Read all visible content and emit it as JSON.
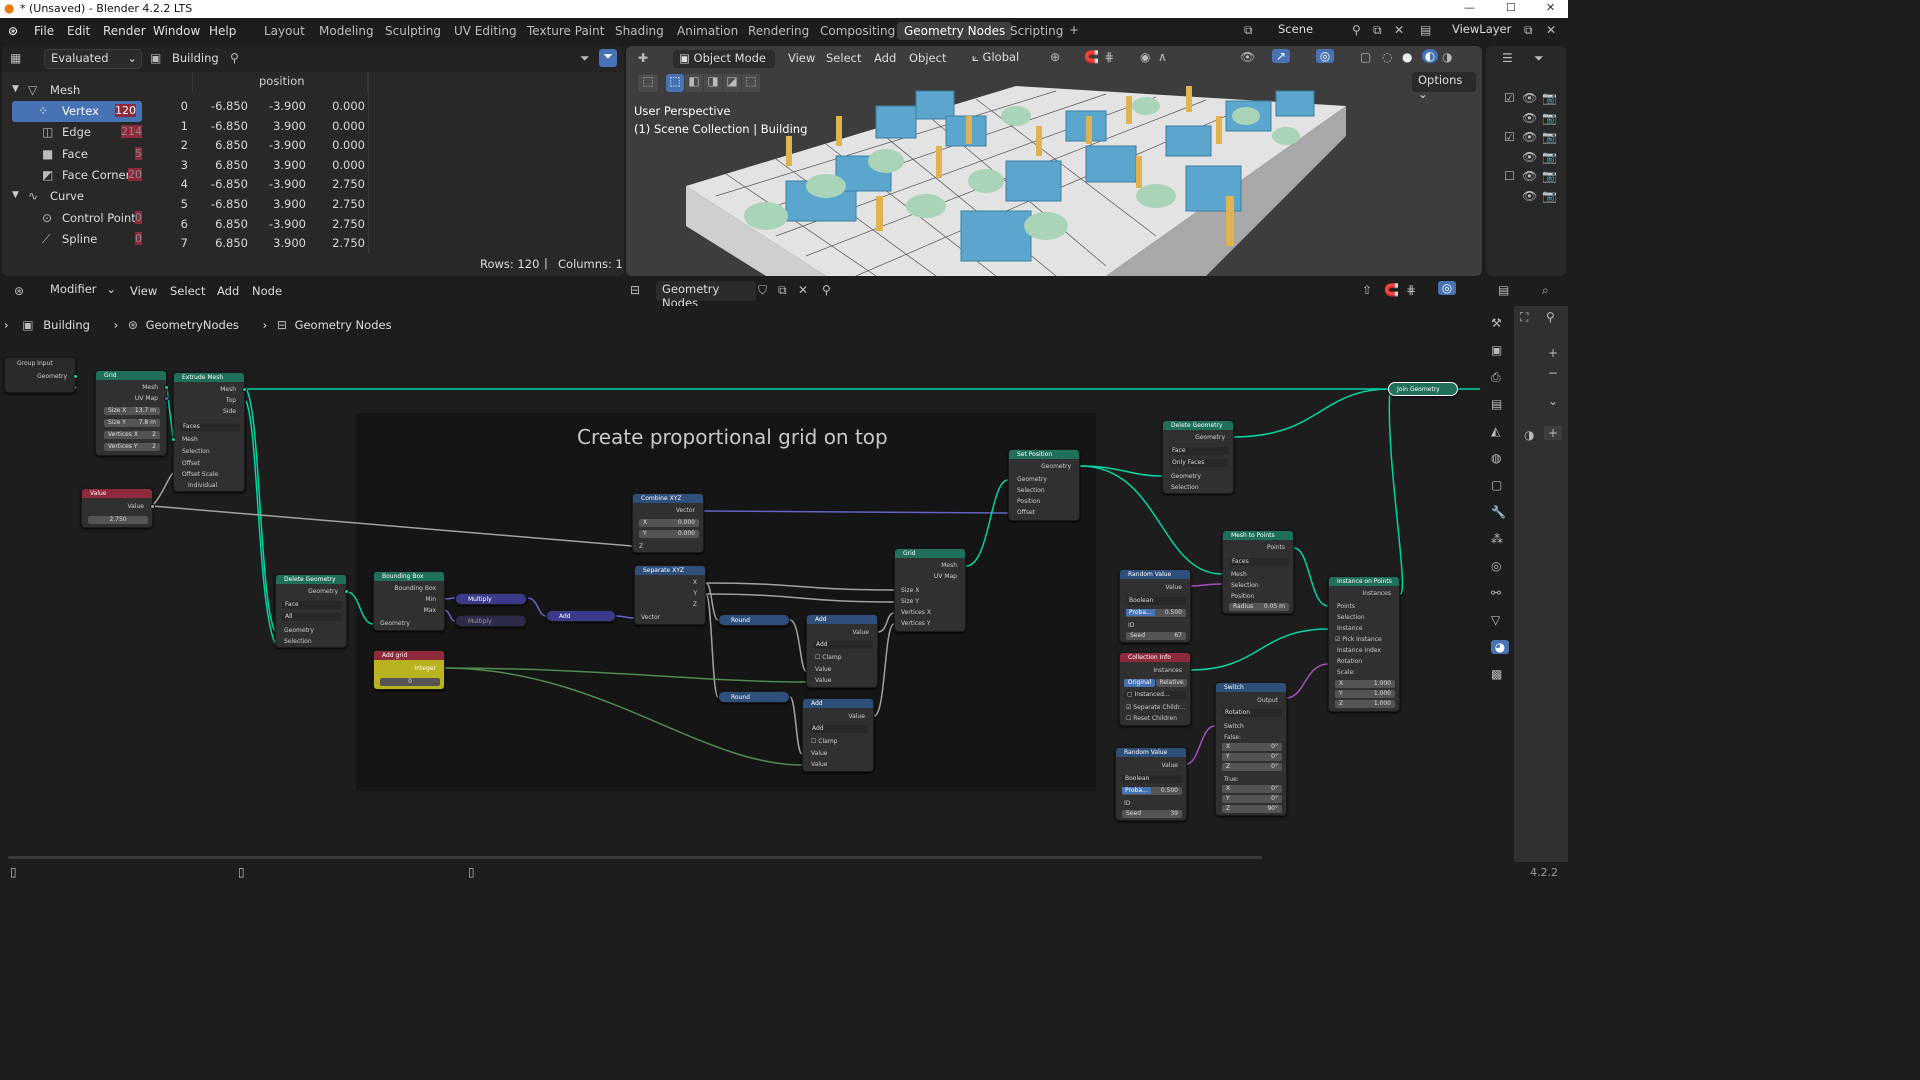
{
  "window": {
    "title": "* (Unsaved) - Blender 4.2.2 LTS"
  },
  "menu": [
    "File",
    "Edit",
    "Render",
    "Window",
    "Help"
  ],
  "workspaces": [
    "Layout",
    "Modeling",
    "Sculpting",
    "UV Editing",
    "Texture Paint",
    "Shading",
    "Animation",
    "Rendering",
    "Compositing",
    "Geometry Nodes",
    "Scripting"
  ],
  "active_workspace": "Geometry Nodes",
  "scene": {
    "scene_label": "Scene",
    "viewlayer_label": "ViewLayer"
  },
  "spreadsheet": {
    "evaluated": "Evaluated",
    "object": "Building",
    "column_header": "position",
    "domains": [
      {
        "group": "Mesh"
      },
      {
        "name": "Vertex",
        "count": "120"
      },
      {
        "name": "Edge",
        "count": "214"
      },
      {
        "name": "Face",
        "count": "5"
      },
      {
        "name": "Face Corner",
        "count": "20"
      },
      {
        "group": "Curve"
      },
      {
        "name": "Control Point",
        "count": "0"
      },
      {
        "name": "Spline",
        "count": "0"
      }
    ],
    "rows": [
      [
        "0",
        "-6.850",
        "-3.900",
        "0.000"
      ],
      [
        "1",
        "-6.850",
        "3.900",
        "0.000"
      ],
      [
        "2",
        "6.850",
        "-3.900",
        "0.000"
      ],
      [
        "3",
        "6.850",
        "3.900",
        "0.000"
      ],
      [
        "4",
        "-6.850",
        "-3.900",
        "2.750"
      ],
      [
        "5",
        "-6.850",
        "3.900",
        "2.750"
      ],
      [
        "6",
        "6.850",
        "-3.900",
        "2.750"
      ],
      [
        "7",
        "6.850",
        "3.900",
        "2.750"
      ]
    ],
    "footer_rows": "Rows: 120",
    "footer_cols": "Columns: 1"
  },
  "viewport": {
    "mode": "Object Mode",
    "menus": [
      "View",
      "Select",
      "Add",
      "Object"
    ],
    "orientation": "Global",
    "options": "Options",
    "perspective": "User Perspective",
    "collection": "(1) Scene Collection | Building"
  },
  "node_editor": {
    "editor_type": "Modifier",
    "menus": [
      "View",
      "Select",
      "Add",
      "Node"
    ],
    "tree_name": "Geometry Nodes",
    "breadcrumb": [
      "Building",
      "GeometryNodes",
      "Geometry Nodes"
    ],
    "frame_label": "Create proportional grid on top",
    "version": "4.2.2"
  },
  "nodes": {
    "group_input": {
      "title": "Group Input",
      "out": "Geometry"
    },
    "grid1": {
      "title": "Grid",
      "outs": [
        "Mesh",
        "UV Map"
      ],
      "size_x": "13.7 m",
      "size_y": "7.8 m",
      "verts_x": "2",
      "verts_y": "2"
    },
    "extrude": {
      "title": "Extrude Mesh",
      "outs": [
        "Mesh",
        "Top",
        "Side"
      ],
      "mode": "Faces",
      "ins": [
        "Mesh",
        "Selection",
        "Offset",
        "Offset Scale",
        "Individual"
      ]
    },
    "value": {
      "title": "Value",
      "label": "Value",
      "val": "2.750"
    },
    "delete1": {
      "title": "Delete Geometry",
      "out": "Geometry",
      "d1": "Face",
      "d2": "All",
      "ins": [
        "Geometry",
        "Selection"
      ]
    },
    "bbox": {
      "title": "Bounding Box",
      "outs": [
        "Bounding Box",
        "Min",
        "Max"
      ],
      "in": "Geometry"
    },
    "multiply1": "Multiply",
    "multiply2": "Multiply",
    "add_vec": "Add",
    "add_grid": {
      "title": "Add grid",
      "label": "Integer",
      "val": "0"
    },
    "combine": {
      "title": "Combine XYZ",
      "out": "Vector",
      "x": "0.000",
      "y": "0.000",
      "z": "Z"
    },
    "separate": {
      "title": "Separate XYZ",
      "outs": [
        "X",
        "Y",
        "Z"
      ],
      "in": "Vector"
    },
    "round1": "Round",
    "round2": "Round",
    "add1": {
      "title": "Add",
      "out": "Value",
      "op": "Add",
      "clamp": "Clamp",
      "ins": [
        "Value",
        "Value"
      ]
    },
    "add2": {
      "title": "Add",
      "out": "Value",
      "op": "Add",
      "clamp": "Clamp",
      "ins": [
        "Value",
        "Value"
      ]
    },
    "grid2": {
      "title": "Grid",
      "outs": [
        "Mesh",
        "UV Map"
      ],
      "ins": [
        "Size X",
        "Size Y",
        "Vertices X",
        "Vertices Y"
      ]
    },
    "setpos": {
      "title": "Set Position",
      "out": "Geometry",
      "ins": [
        "Geometry",
        "Selection",
        "Position",
        "Offset"
      ]
    },
    "delete2": {
      "title": "Delete Geometry",
      "out": "Geometry",
      "d1": "Face",
      "d2": "Only Faces",
      "ins": [
        "Geometry",
        "Selection"
      ]
    },
    "mesh2pts": {
      "title": "Mesh to Points",
      "out": "Points",
      "mode": "Faces",
      "ins": [
        "Mesh",
        "Selection",
        "Position"
      ],
      "radius": "Radius",
      "radius_val": "0.05 m"
    },
    "rand1": {
      "title": "Random Value",
      "out": "Value",
      "type": "Boolean",
      "prob": "Proba...",
      "prob_val": "0.500",
      "id": "ID",
      "seed": "Seed",
      "seed_val": "67"
    },
    "collinfo": {
      "title": "Collection Info",
      "out": "Instances",
      "b1": "Original",
      "b2": "Relative",
      "coll": "Instanced...",
      "sep": "Separate Childr...",
      "reset": "Reset Children"
    },
    "rand2": {
      "title": "Random Value",
      "out": "Value",
      "type": "Boolean",
      "prob": "Proba...",
      "prob_val": "0.500",
      "id": "ID",
      "seed": "Seed",
      "seed_val": "39"
    },
    "switch": {
      "title": "Switch",
      "out": "Output",
      "type": "Rotation",
      "sw": "Switch",
      "false": "False:",
      "true": "True:",
      "fx": "0°",
      "fy": "0°",
      "fz": "0°",
      "tx": "0°",
      "ty": "0°",
      "tz": "90°"
    },
    "inst": {
      "title": "Instance on Points",
      "out": "Instances",
      "ins": [
        "Points",
        "Selection",
        "Instance",
        "Pick Instance",
        "Instance Index",
        "Rotation",
        "Scale:"
      ],
      "sx": "1.000",
      "sy": "1.000",
      "sz": "1.000"
    },
    "join": "Join Geometry"
  },
  "colors": {
    "accent": "#4772b3",
    "geometry": "#00d6a3",
    "float": "#a1a1a1",
    "vector": "#6363c7"
  }
}
